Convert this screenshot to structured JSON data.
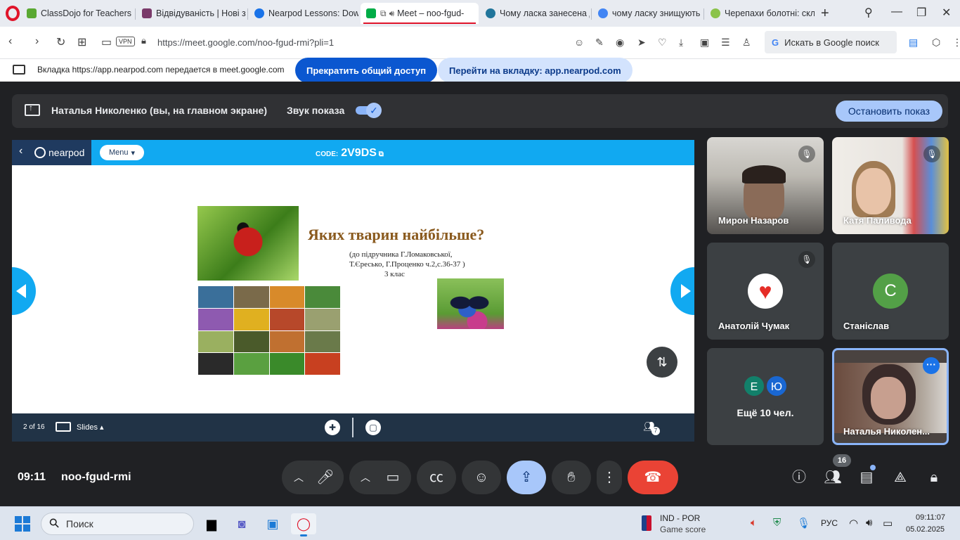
{
  "browser": {
    "tabs": [
      {
        "label": "ClassDojo for Teachers",
        "color": "#5aa832"
      },
      {
        "label": "Відвідуваність | Нові зн",
        "color": "#7a3a6a"
      },
      {
        "label": "Nearpod Lessons: Down",
        "color": "#1a73e8"
      },
      {
        "label": "Meet – noo-fgud-",
        "color": "#00ac47",
        "active": true
      },
      {
        "label": "Чому ласка занесена до",
        "color": "#21759b"
      },
      {
        "label": "чому ласку знищують -",
        "color": "#4285f4"
      },
      {
        "label": "Черепахи болотні: скла",
        "color": "#8bc34a"
      }
    ],
    "url": "https://meet.google.com/noo-fgud-rmi?pli=1",
    "vpn_label": "VPN",
    "search_label": "Искать в Google поиск",
    "share_notice": "Вкладка https://app.nearpod.com передается в meet.google.com",
    "stop_share_label": "Прекратить общий доступ",
    "goto_tab_label": "Перейти на вкладку: app.nearpod.com"
  },
  "meet": {
    "present_name": "Наталья Николенко (вы, на главном экране)",
    "sound_label": "Звук показа",
    "stop_present_label": "Остановить показ",
    "time": "09:11",
    "meeting_code": "noo-fgud-rmi",
    "participants_count": "16",
    "participants": [
      {
        "name": "Мирон Назаров",
        "muted": true
      },
      {
        "name": "Катя Паливода",
        "muted": true
      },
      {
        "name": "Анатолій Чумак",
        "muted": true
      },
      {
        "name": "Станіслав",
        "initial": "С",
        "color": "#53a047"
      },
      {
        "more_label": "Ещё 10 чел.",
        "initials": [
          "Е",
          "Ю"
        ],
        "colors": [
          "#12806a",
          "#1967d2"
        ]
      },
      {
        "name": "Наталья Николен...",
        "self": true
      }
    ]
  },
  "nearpod": {
    "brand": "nearpod",
    "menu_label": "Menu",
    "code_label": "CODE:",
    "code": "2V9DS",
    "page_indicator": "2 of 16",
    "slides_label": "Slides",
    "students_count": "7",
    "slide": {
      "title": "Яких тварин найбільше?",
      "subtitle_line1": "(до підручника Г.Ломаковської,",
      "subtitle_line2": "Т.Єресько, Г.Проценко ч.2,с.36-37 )",
      "subtitle_line3": "3 клас"
    }
  },
  "taskbar": {
    "search_label": "Поиск",
    "game_line1": "IND - POR",
    "game_line2": "Game score",
    "language": "РУС",
    "time": "09:11:07",
    "date": "05.02.2025"
  }
}
